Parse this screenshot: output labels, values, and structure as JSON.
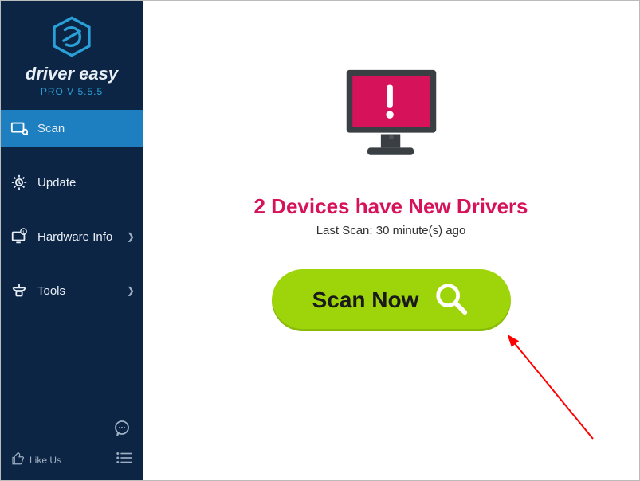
{
  "brand": {
    "name": "driver easy",
    "version": "PRO V 5.5.5"
  },
  "sidebar": {
    "items": [
      {
        "label": "Scan"
      },
      {
        "label": "Update"
      },
      {
        "label": "Hardware Info"
      },
      {
        "label": "Tools"
      }
    ],
    "like": "Like Us"
  },
  "main": {
    "headline": "2 Devices have New Drivers",
    "last_scan": "Last Scan: 30 minute(s) ago",
    "scan_button": "Scan Now"
  }
}
